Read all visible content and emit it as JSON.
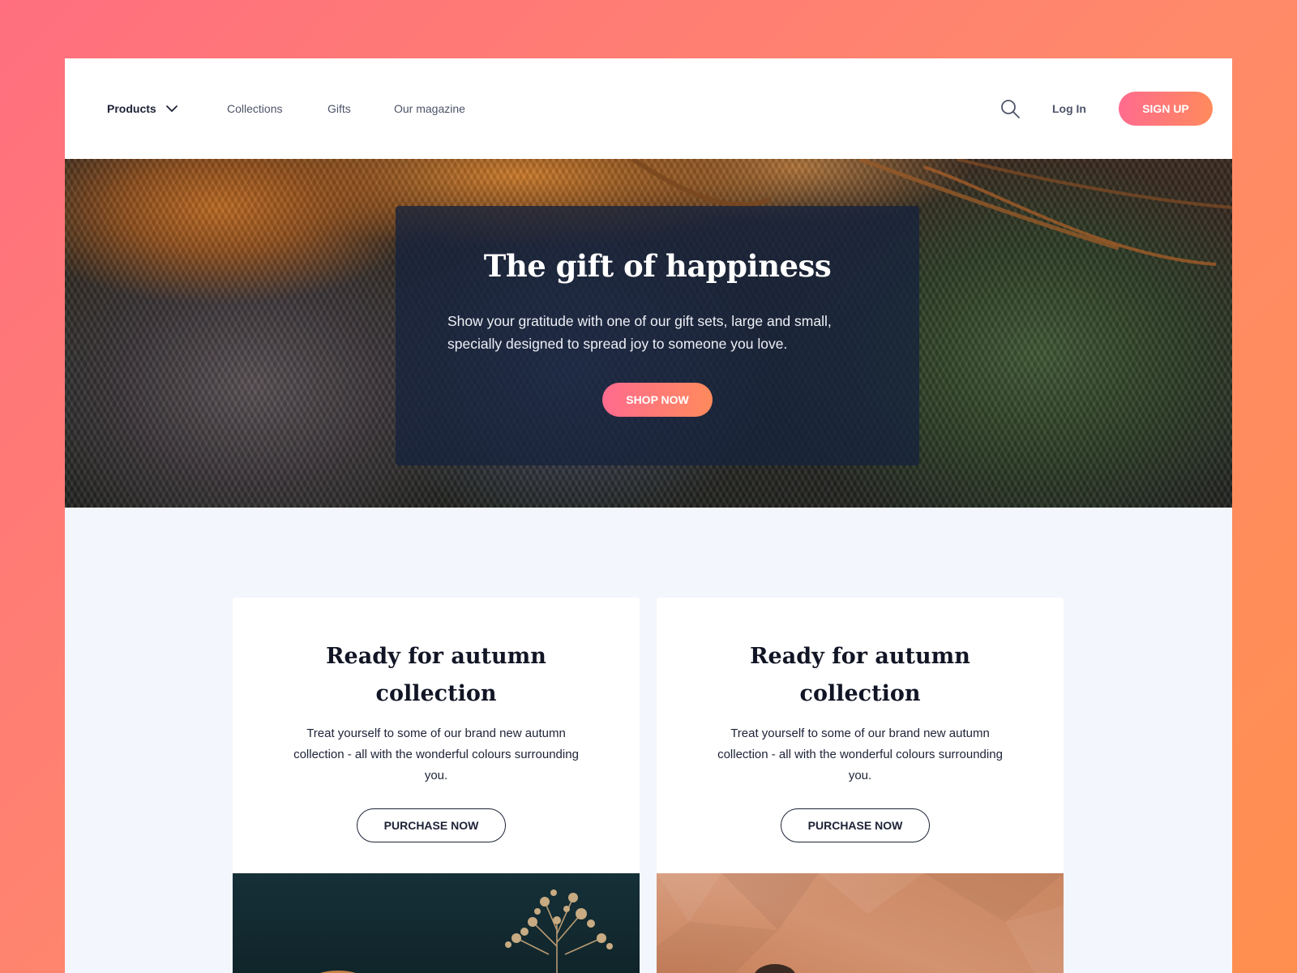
{
  "nav": {
    "products_label": "Products",
    "links": [
      "Collections",
      "Gifts",
      "Our magazine"
    ],
    "login_label": "Log In",
    "signup_label": "SIGN UP",
    "icons": {
      "search": "search-icon",
      "dropdown": "chevron-down-icon"
    }
  },
  "hero": {
    "title": "The gift of happiness",
    "text": "Show your gratitude with one of our gift sets, large and small, specially designed to spread joy to someone you love.",
    "button_label": "SHOP NOW"
  },
  "cards": [
    {
      "title": "Ready for autumn collection",
      "text": "Treat yourself to some of our brand new autumn collection - all with the wonderful colours surrounding you.",
      "button_label": "PURCHASE NOW"
    },
    {
      "title": "Ready for autumn collection",
      "text": "Treat yourself to some of our brand new autumn collection - all with the wonderful colours surrounding you.",
      "button_label": "PURCHASE NOW"
    }
  ],
  "colors": {
    "accent_start": "#ff6b8e",
    "accent_end": "#ff8a5c",
    "text_dark": "#1d2236",
    "page_bg": "#f3f6fc"
  }
}
